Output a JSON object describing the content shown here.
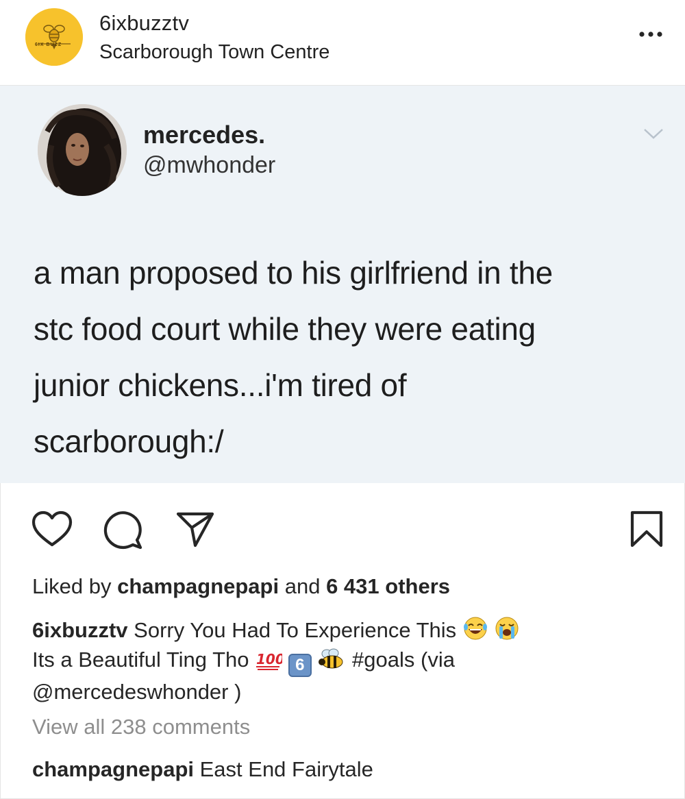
{
  "post": {
    "username": "6ixbuzztv",
    "location": "Scarborough Town Centre",
    "avatar_label": "6IX BUZZ"
  },
  "tweet": {
    "name": "mercedes.",
    "handle": "@mwhonder",
    "text_lines": [
      "a man proposed to his girlfriend in the",
      "stc food court while they were eating",
      "junior chickens...i'm tired of",
      "scarborough:/"
    ]
  },
  "actions": {
    "like_icon": "heart-icon",
    "comment_icon": "comment-icon",
    "share_icon": "send-icon",
    "save_icon": "bookmark-icon"
  },
  "likes": {
    "prefix": "Liked by",
    "user": "champagnepapi",
    "middle": "and",
    "count": "6 431 others"
  },
  "caption": {
    "user": "6ixbuzztv",
    "text_1": "Sorry You Had To Experience This",
    "text_2": "Its a Beautiful Ting Tho",
    "hashtag": "#goals",
    "via_prefix": "(via",
    "via_user": "@mercedeswhonder",
    "via_suffix": ")",
    "emoji_badge": "6"
  },
  "view_comments": "View all 238 comments",
  "comment": {
    "user": "champagnepapi",
    "text": "East End Fairytale"
  },
  "colors": {
    "tweet_background": "#eef3f7",
    "avatar_yellow": "#f7c22c",
    "muted_text": "#8e8e8e"
  }
}
